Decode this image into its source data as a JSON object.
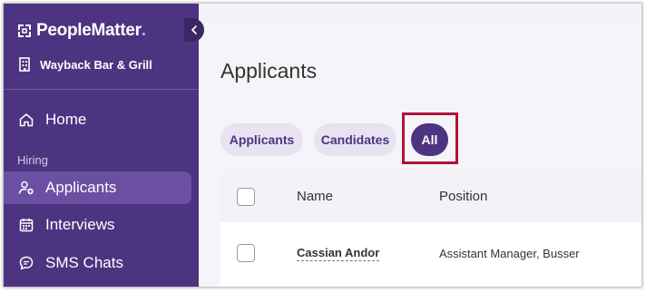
{
  "brand": {
    "name": "PeopleMatter",
    "dot": "."
  },
  "location": {
    "name": "Wayback Bar & Grill"
  },
  "nav": {
    "home": "Home",
    "section_hiring": "Hiring",
    "applicants": "Applicants",
    "interviews": "Interviews",
    "sms_chats": "SMS Chats"
  },
  "page": {
    "title": "Applicants"
  },
  "filters": {
    "applicants": "Applicants",
    "candidates": "Candidates",
    "all": "All",
    "selected": "All"
  },
  "table": {
    "columns": [
      "Name",
      "Position"
    ],
    "rows": [
      {
        "name": "Cassian Andor",
        "position": "Assistant Manager, Busser"
      }
    ]
  },
  "colors": {
    "sidebar": "#4d3481",
    "accent": "#4d3481",
    "chip_bg": "#e8e3f0",
    "highlight": "#b0123a"
  },
  "icons": {
    "logo": "peoplematter-logo-icon",
    "location": "building-icon",
    "collapse": "chevron-left-icon",
    "home": "home-icon",
    "applicants": "user-add-icon",
    "interviews": "calendar-icon",
    "sms": "chat-bubble-icon"
  }
}
